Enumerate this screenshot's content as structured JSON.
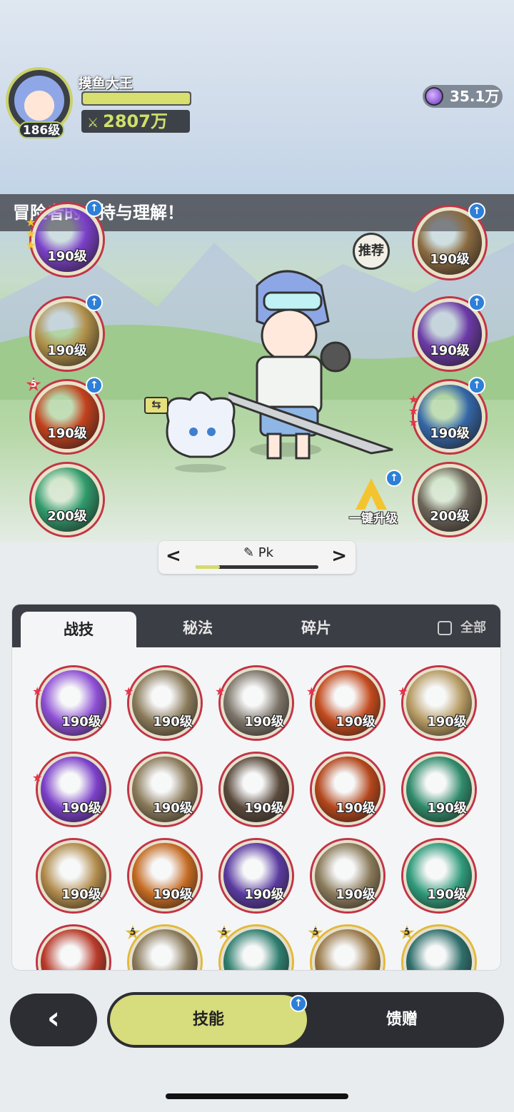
{
  "player": {
    "name": "摸鱼大王",
    "level": "186级",
    "hp_fraction": 1.0,
    "power": "2807万",
    "power_icon": "crossed-swords-icon"
  },
  "currency": {
    "amount": "35.1万",
    "icon": "purple-gem-icon"
  },
  "banner": {
    "text": "冒险者的支持与理解！"
  },
  "left_skills": [
    {
      "name": "violet-vortex",
      "level": "190级",
      "stars": 3,
      "upgrade": true,
      "color": "#7b3fc9"
    },
    {
      "name": "golden-whirl",
      "level": "190级",
      "stars": 0,
      "upgrade": true,
      "color": "#b0904a"
    },
    {
      "name": "fire-swirl",
      "level": "190级",
      "badge": "5",
      "upgrade": true,
      "color": "#c2411d"
    },
    {
      "name": "jade-ring",
      "level": "200级",
      "stars": 0,
      "upgrade": false,
      "color": "#2f9a6b"
    }
  ],
  "right_skills": [
    {
      "name": "sand-fist",
      "level": "190级",
      "upgrade": true,
      "color": "#8a6a40"
    },
    {
      "name": "arcane-burst",
      "level": "190级",
      "upgrade": true,
      "color": "#6b3aa6"
    },
    {
      "name": "ice-crest",
      "level": "190级",
      "stars": 3,
      "upgrade": true,
      "color": "#3466a7"
    },
    {
      "name": "stone-figure",
      "level": "200级",
      "upgrade": false,
      "color": "#6c6458"
    }
  ],
  "recommend_label": "推荐",
  "upgrade_all_label": "一键升级",
  "swap_icon": "swap-arrows-icon",
  "preset": {
    "name": "Pk",
    "edit_icon": "pencil-icon",
    "progress": 0.2
  },
  "tabs": [
    {
      "label": "战技",
      "active": true
    },
    {
      "label": "秘法",
      "active": false
    },
    {
      "label": "碎片",
      "active": false
    }
  ],
  "all_label": "全部",
  "grid": [
    {
      "level": "190级",
      "color": "#8d4fd4",
      "star": true
    },
    {
      "level": "190级",
      "color": "#8a7a5a",
      "star": true
    },
    {
      "level": "190级",
      "color": "#7c7468",
      "star": true
    },
    {
      "level": "190级",
      "color": "#c24a1e",
      "star": true
    },
    {
      "level": "190级",
      "color": "#b59a62",
      "star": true
    },
    {
      "level": "190级",
      "color": "#7a3fc8",
      "star": true
    },
    {
      "level": "190级",
      "color": "#8a7a5a",
      "star": false
    },
    {
      "level": "190级",
      "color": "#5a4a3c",
      "star": false
    },
    {
      "level": "190级",
      "color": "#b3461b",
      "star": false
    },
    {
      "level": "190级",
      "color": "#2f8a6a",
      "star": false
    },
    {
      "level": "190级",
      "color": "#b08a4a",
      "star": false
    },
    {
      "level": "190级",
      "color": "#c46a22",
      "star": false
    },
    {
      "level": "190级",
      "color": "#5a3aa0",
      "star": false
    },
    {
      "level": "190级",
      "color": "#8a7a5a",
      "star": false
    },
    {
      "level": "190级",
      "color": "#2f9a7a",
      "star": false
    },
    {
      "level": "",
      "color": "#b83a2a",
      "star": false,
      "badge": ""
    },
    {
      "level": "",
      "color": "#8a7a5a",
      "star": false,
      "badge": "5"
    },
    {
      "level": "",
      "color": "#2e7e6e",
      "star": false,
      "badge": "5"
    },
    {
      "level": "",
      "color": "#9a7a4a",
      "star": false,
      "badge": "5"
    },
    {
      "level": "",
      "color": "#2e6e6a",
      "star": false,
      "badge": "5"
    }
  ],
  "bottom": {
    "back_icon": "chevron-left-icon",
    "tab_skill": "技能",
    "tab_gift": "馈赠"
  }
}
